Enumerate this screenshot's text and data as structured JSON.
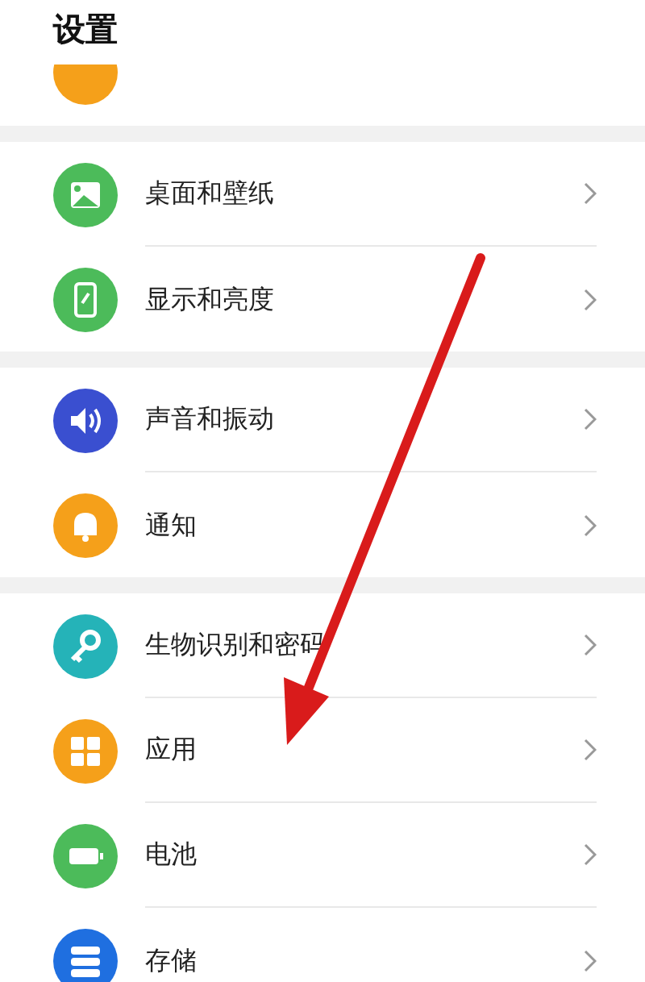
{
  "header": {
    "title": "设置"
  },
  "groups": [
    {
      "items": [
        {
          "label": "桌面和壁纸",
          "color": "#4cbb5a"
        },
        {
          "label": "显示和亮度",
          "color": "#4cbb5a"
        }
      ]
    },
    {
      "items": [
        {
          "label": "声音和振动",
          "color": "#3a4fd0"
        },
        {
          "label": "通知",
          "color": "#f5a01a"
        }
      ]
    },
    {
      "items": [
        {
          "label": "生物识别和密码",
          "color": "#25b3b8"
        },
        {
          "label": "应用",
          "color": "#f5a01a"
        },
        {
          "label": "电池",
          "color": "#4cbb5a"
        },
        {
          "label": "存储",
          "color": "#1f6fe0"
        }
      ]
    }
  ]
}
